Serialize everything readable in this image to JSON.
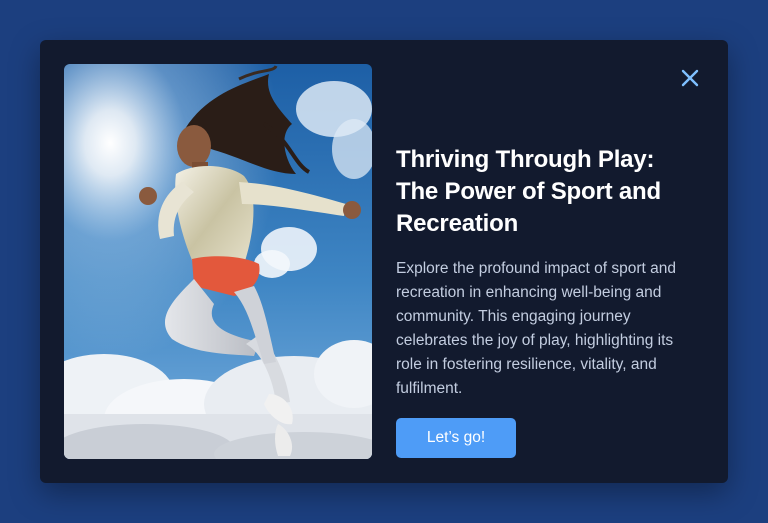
{
  "modal": {
    "title": "Thriving Through Play: The Power of Sport and Recreation",
    "description": "Explore the profound impact of sport and recreation in enhancing well-being and community. This engaging journey celebrates the joy of play, highlighting its role in fostering resilience, vitality, and fulfilment.",
    "cta_label": "Let’s go!",
    "close_icon": "close-icon"
  },
  "colors": {
    "page_background": "#1c3f7f",
    "modal_background": "#121a2e",
    "accent": "#4e9cf7",
    "close_icon": "#7fc0ff"
  }
}
